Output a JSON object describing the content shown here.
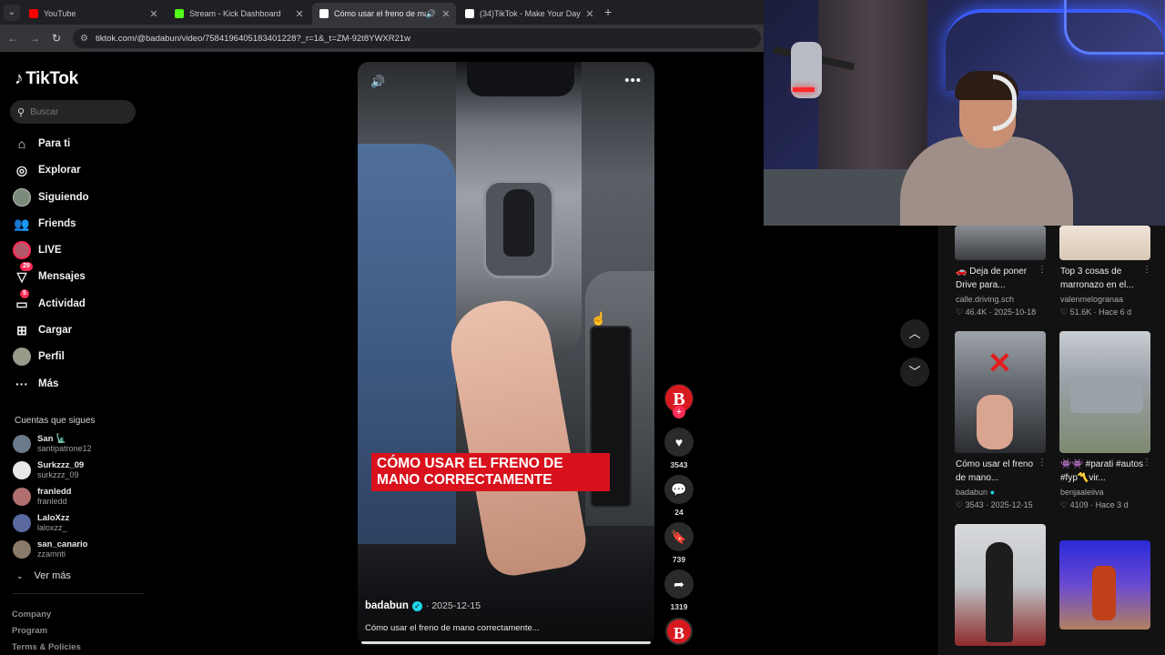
{
  "browser": {
    "tabs": [
      {
        "title": "YouTube",
        "color": "#ff0000",
        "active": false
      },
      {
        "title": "Stream - Kick Dashboard",
        "color": "#53fc18",
        "active": false
      },
      {
        "title": "Cómo usar el freno de mano",
        "color": "#ffffff",
        "active": true
      },
      {
        "title": "(34)TikTok - Make Your Day",
        "color": "#ffffff",
        "active": false
      }
    ],
    "url": "tiktok.com/@badabun/video/7584196405183401228?_r=1&_t=ZM-92t8YWXR21w"
  },
  "sidebar": {
    "logo": "TikTok",
    "search_placeholder": "Buscar",
    "nav": [
      {
        "label": "Para ti",
        "icon": "home-icon"
      },
      {
        "label": "Explorar",
        "icon": "compass-icon"
      },
      {
        "label": "Siguiendo",
        "icon": "avatar-icon"
      },
      {
        "label": "Friends",
        "icon": "friends-icon"
      },
      {
        "label": "LIVE",
        "icon": "live-icon"
      },
      {
        "label": "Mensajes",
        "icon": "messages-icon",
        "badge": "29"
      },
      {
        "label": "Actividad",
        "icon": "activity-icon",
        "badge": "5"
      },
      {
        "label": "Cargar",
        "icon": "upload-icon"
      },
      {
        "label": "Perfil",
        "icon": "profile-icon"
      },
      {
        "label": "Más",
        "icon": "more-icon"
      }
    ],
    "following_label": "Cuentas que sigues",
    "following": [
      {
        "name": "San 🗽",
        "handle": "santipatrone12",
        "color": "#6a7a8a"
      },
      {
        "name": "Surkzzz_09",
        "handle": "surkzzz_09",
        "color": "#e8e8e8"
      },
      {
        "name": "franledd",
        "handle": "franledd",
        "color": "#b07070"
      },
      {
        "name": "LaloXzz",
        "handle": "laloxzz_",
        "color": "#5a6aa0"
      },
      {
        "name": "san_canario",
        "handle": "zzamnti",
        "color": "#8a7a6a"
      }
    ],
    "see_more": "Ver más",
    "footer": [
      "Company",
      "Program",
      "Terms & Policies"
    ]
  },
  "video": {
    "overlay_text": "Cómo usar el freno de mano correctamente",
    "author": "badabun",
    "date": "2025-12-15",
    "description": "Cómo usar el freno de mano correctamente...",
    "progress": 1.0,
    "avatar_letter": "B"
  },
  "actions": {
    "likes": "3543",
    "comments": "24",
    "saves": "739",
    "shares": "1319"
  },
  "related": [
    {
      "title": "🚗 Deja de poner Drive para...",
      "author": "calle.driving.sch",
      "likes": "46.4K",
      "date": "2025-10-18",
      "verified": false
    },
    {
      "title": "Top 3 cosas de marronazo en el...",
      "author": "valenmelogranaa",
      "likes": "51.6K",
      "date": "Hace 6 d",
      "verified": false
    },
    {
      "title": "Cómo usar el freno de mano...",
      "author": "badabun",
      "likes": "3543",
      "date": "2025-12-15",
      "verified": true
    },
    {
      "title": "👾👾 #parati #autos #fyp〽️vir...",
      "author": "benjaaleiiva",
      "likes": "4109",
      "date": "Hace 3 d",
      "verified": false
    }
  ]
}
